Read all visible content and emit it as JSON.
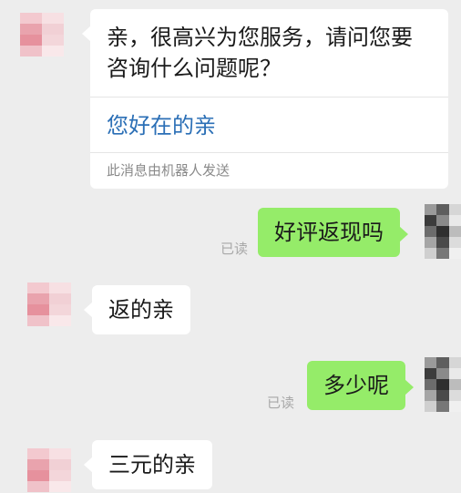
{
  "messages": [
    {
      "side": "left",
      "text": "亲，很高兴为您服务，请问您要咨询什么问题呢？",
      "link": "您好在的亲",
      "footer": "此消息由机器人发送"
    },
    {
      "side": "right",
      "text": "好评返现吗",
      "status": "已读"
    },
    {
      "side": "left",
      "text": "返的亲"
    },
    {
      "side": "right",
      "text": "多少呢",
      "status": "已读"
    },
    {
      "side": "left",
      "text": "三元的亲"
    }
  ],
  "colors": {
    "background": "#ededed",
    "incoming_bubble": "#ffffff",
    "outgoing_bubble": "#95ec69",
    "link": "#2b6fb6",
    "muted": "#a8a8a8"
  }
}
